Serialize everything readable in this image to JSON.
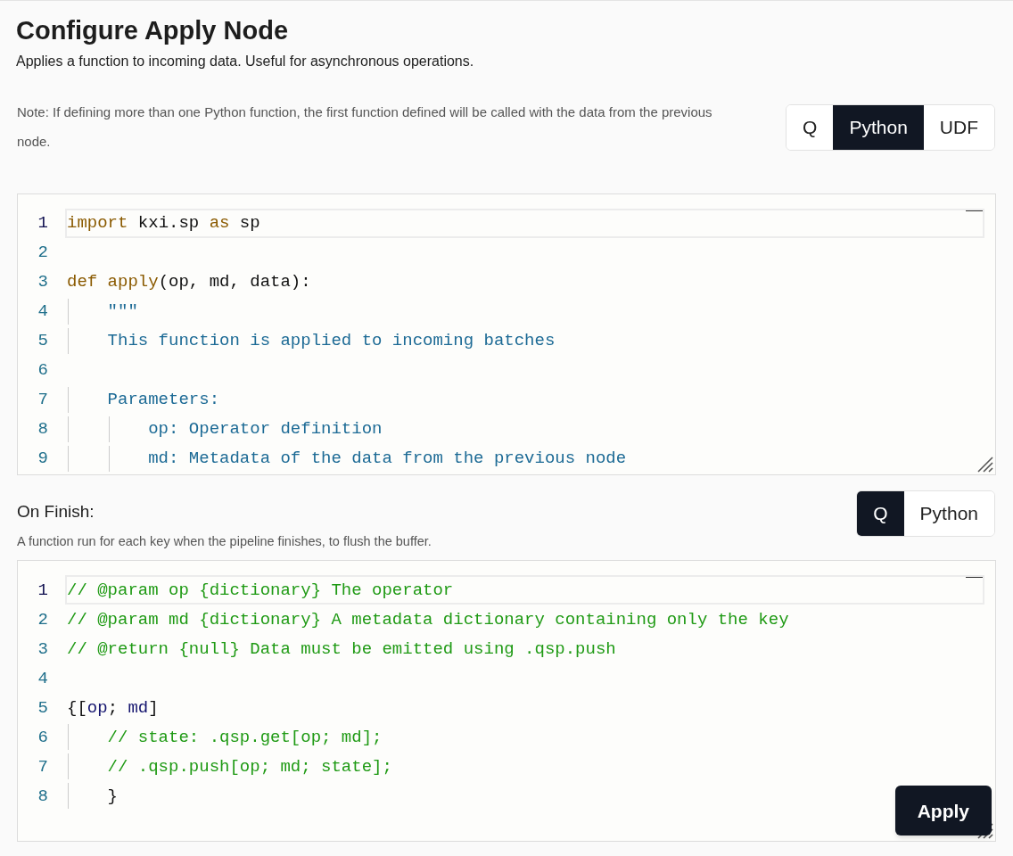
{
  "title": "Configure Apply Node",
  "description": "Applies a function to incoming data. Useful for asynchronous operations.",
  "note": "Note: If defining more than one Python function, the first function defined will be called with the data from the previous node.",
  "language_tabs": [
    {
      "label": "Q",
      "selected": false
    },
    {
      "label": "Python",
      "selected": true
    },
    {
      "label": "UDF",
      "selected": false
    }
  ],
  "editor": {
    "lines": [
      {
        "number": "1",
        "active": true,
        "tokens": [
          {
            "text": "import",
            "kind": "keyword"
          },
          {
            "text": " kxi.sp ",
            "kind": "plain"
          },
          {
            "text": "as",
            "kind": "keyword"
          },
          {
            "text": " sp",
            "kind": "plain"
          }
        ]
      },
      {
        "number": "2",
        "active": false
      },
      {
        "number": "3",
        "active": false,
        "tokens": [
          {
            "text": "def",
            "kind": "keyword"
          },
          {
            "text": " apply",
            "kind": "keyword"
          },
          {
            "text": "(op, md, data):",
            "kind": "plain"
          }
        ]
      },
      {
        "number": "4",
        "active": false,
        "tokens": [
          {
            "text": "    \"\"\"",
            "kind": "docstring"
          }
        ]
      },
      {
        "number": "5",
        "active": false,
        "tokens": [
          {
            "text": "    This function is applied to incoming batches",
            "kind": "docstring"
          }
        ]
      },
      {
        "number": "6",
        "active": false
      },
      {
        "number": "7",
        "active": false,
        "tokens": [
          {
            "text": "    Parameters:",
            "kind": "docstring"
          }
        ]
      },
      {
        "number": "8",
        "active": false,
        "tokens": [
          {
            "text": "        op: Operator definition",
            "kind": "docstring"
          }
        ]
      },
      {
        "number": "9",
        "active": false,
        "tokens": [
          {
            "text": "        md: Metadata of the data from the previous node",
            "kind": "docstring"
          }
        ]
      }
    ]
  },
  "on_finish": {
    "label": "On Finish:",
    "description": "A function run for each key when the pipeline finishes, to flush the buffer.",
    "language_tabs": [
      {
        "label": "Q",
        "selected": true
      },
      {
        "label": "Python",
        "selected": false
      }
    ],
    "editor": {
      "lines": [
        {
          "number": "1",
          "active": true,
          "tokens": [
            {
              "text": "// @param op {dictionary} The operator",
              "kind": "comment"
            }
          ]
        },
        {
          "number": "2",
          "active": false,
          "tokens": [
            {
              "text": "// @param md {dictionary} A metadata dictionary containing only the key",
              "kind": "comment"
            }
          ]
        },
        {
          "number": "3",
          "active": false,
          "tokens": [
            {
              "text": "// @return {null} Data must be emitted using .qsp.push",
              "kind": "comment"
            }
          ]
        },
        {
          "number": "4",
          "active": false
        },
        {
          "number": "5",
          "active": false,
          "tokens": [
            {
              "text": "{[",
              "kind": "plain"
            },
            {
              "text": "op",
              "kind": "param"
            },
            {
              "text": "; ",
              "kind": "plain"
            },
            {
              "text": "md",
              "kind": "param"
            },
            {
              "text": "]",
              "kind": "plain"
            }
          ]
        },
        {
          "number": "6",
          "active": false,
          "tokens": [
            {
              "text": "    // state: .qsp.get[op; md];",
              "kind": "comment"
            }
          ]
        },
        {
          "number": "7",
          "active": false,
          "tokens": [
            {
              "text": "    // .qsp.push[op; md; state];",
              "kind": "comment"
            }
          ]
        },
        {
          "number": "8",
          "active": false,
          "tokens": [
            {
              "text": "    }",
              "kind": "plain"
            }
          ]
        }
      ]
    }
  },
  "apply_button": "Apply"
}
